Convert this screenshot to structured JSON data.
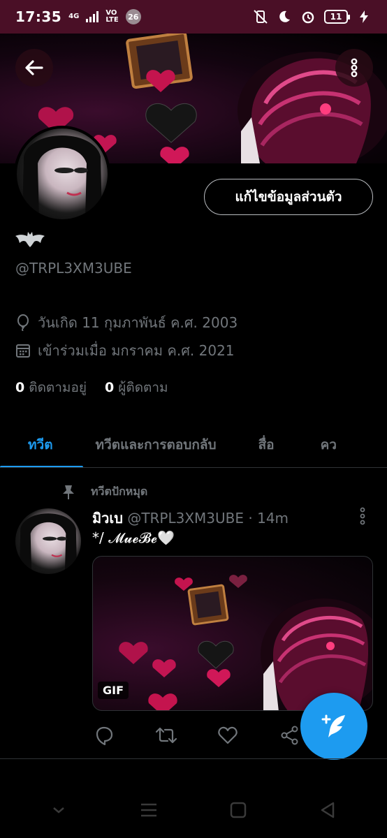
{
  "status_bar": {
    "time": "17:35",
    "network_type": "4G",
    "volte_top": "VO",
    "volte_bottom": "LTE",
    "notification_count": "26",
    "battery_level": "11"
  },
  "profile": {
    "edit_profile_label": "แก้ไขข้อมูลส่วนตัว",
    "handle": "@TRPL3XM3UBE",
    "birthday": "วันเกิด 11 กุมภาพันธ์ ค.ศ. 2003",
    "joined": "เข้าร่วมเมื่อ มกราคม ค.ศ. 2021",
    "following_count": "0",
    "following_label": "ติดตามอยู่",
    "followers_count": "0",
    "followers_label": "ผู้ติดตาม"
  },
  "tabs": [
    {
      "label": "ทวีต",
      "active": true
    },
    {
      "label": "ทวีตและการตอบกลับ",
      "active": false
    },
    {
      "label": "สื่อ",
      "active": false
    },
    {
      "label": "คว",
      "active": false
    }
  ],
  "tweet": {
    "pinned_label": "ทวีตปักหมุด",
    "display_name": "มิวเบ",
    "handle": "@TRPL3XM3UBE",
    "separator": "·",
    "time": "14m",
    "text": "*/ 𝓜𝓾𝓮𝓑𝓮🤍",
    "media_badge": "GIF"
  },
  "colors": {
    "accent": "#1d9bf0",
    "status_bar_bg": "#4a0f26",
    "secondary_text": "#71767b"
  }
}
